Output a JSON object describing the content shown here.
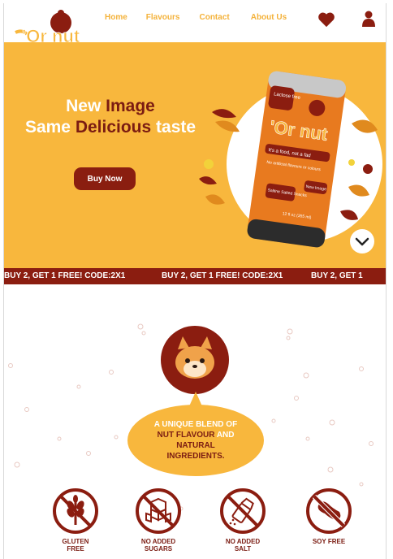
{
  "brand": {
    "name": "Or nut"
  },
  "nav": {
    "items": [
      "Home",
      "Flavours",
      "Contact",
      "About Us"
    ]
  },
  "icons": {
    "favorite": "heart-icon",
    "account": "user-icon",
    "scroll": "chevron-down-icon"
  },
  "hero": {
    "title_line1_a": "New ",
    "title_line1_b": "Image",
    "title_line2_a": "Same ",
    "title_line2_b": "Delicious",
    "title_line2_c": " taste",
    "cta": "Buy Now",
    "can": {
      "tag_top": "Lactose free",
      "slogan": "It's a food, not a fad",
      "sub": "No artificial flavours or colours",
      "tag_left": "Saltine Salted Snacks",
      "tag_right": "New Image",
      "volume": "12 fl oz (355 ml)"
    }
  },
  "promo": {
    "text": "BUY 2, GET 1 FREE! CODE:2X1",
    "text_tail": "BUY 2, GET 1"
  },
  "blurb": {
    "line_a": "A UNIQUE BLEND OF",
    "line_b": "NUT FLAVOUR",
    "line_c": " AND",
    "line_d": "NATURAL",
    "line_e": "INGREDIENTS."
  },
  "badges": [
    {
      "label": "GLUTEN\nFREE",
      "icon": "wheat-icon"
    },
    {
      "label": "NO ADDED\nSUGARS",
      "icon": "sugar-cubes-icon"
    },
    {
      "label": "NO ADDED\nSALT",
      "icon": "salt-shaker-icon"
    },
    {
      "label": "SOY FREE",
      "icon": "soy-icon"
    }
  ],
  "colors": {
    "accent": "#f8b73d",
    "dark": "#8b1d10",
    "brown": "#7b1c12",
    "white": "#ffffff"
  }
}
